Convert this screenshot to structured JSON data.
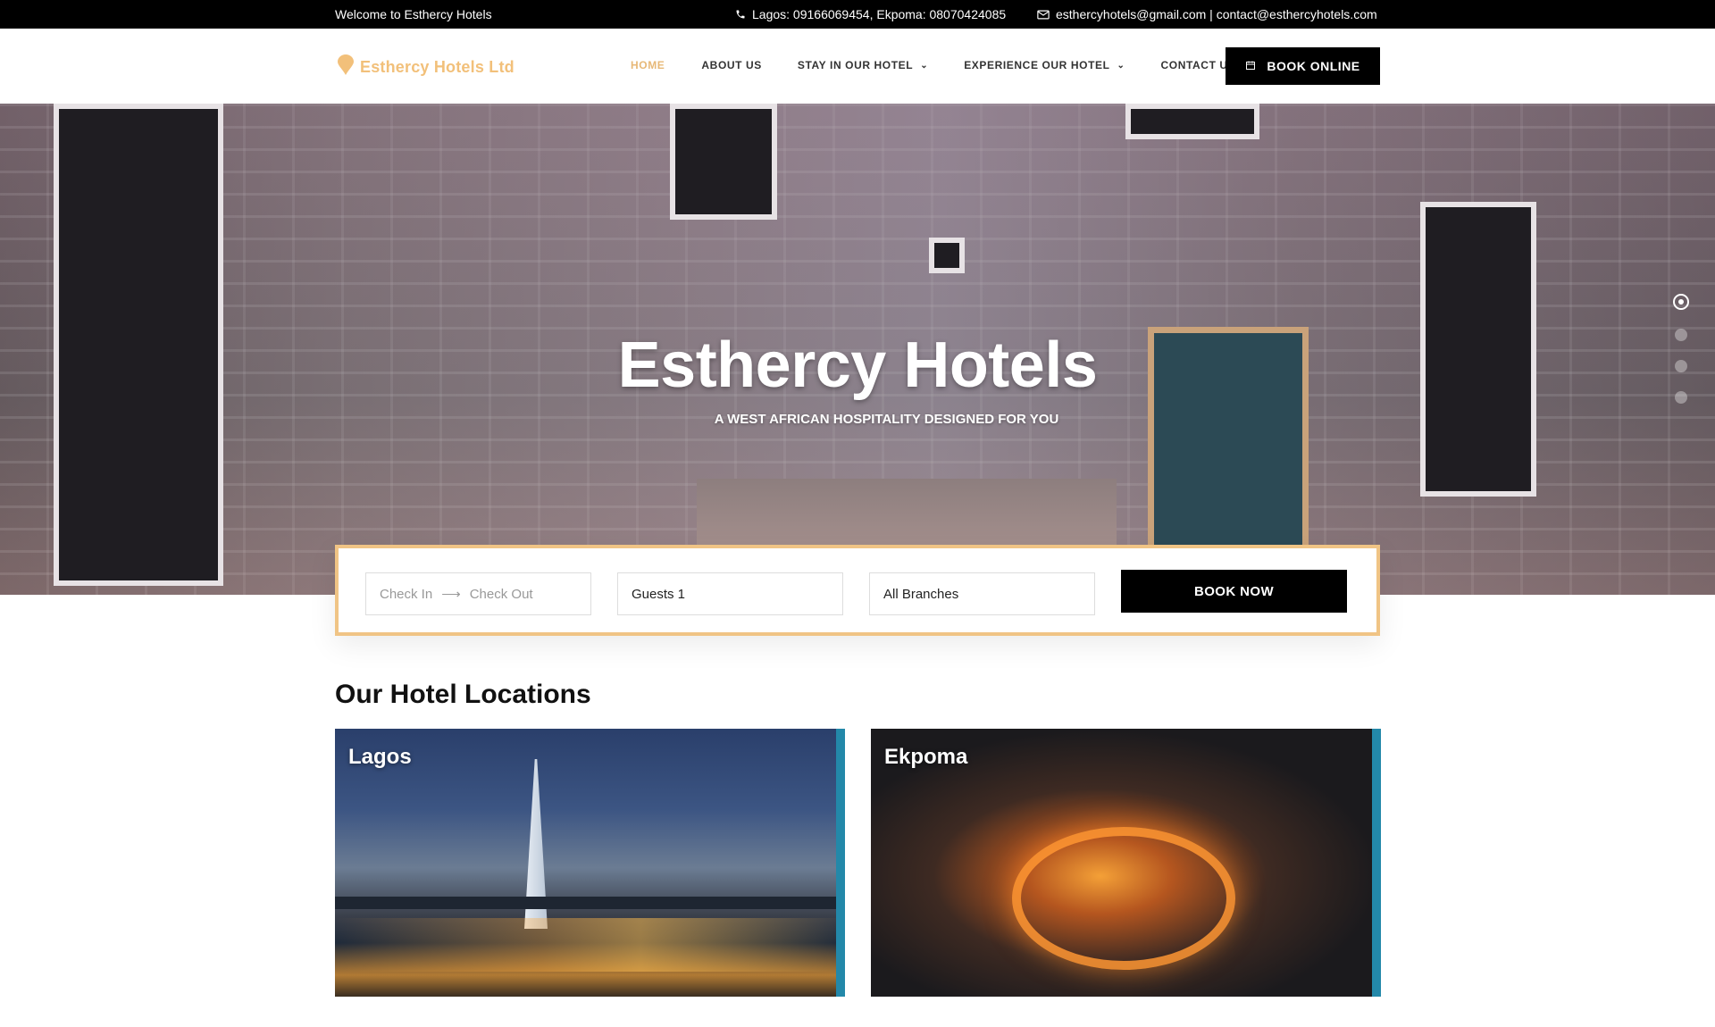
{
  "topbar": {
    "welcome": "Welcome to Esthercy Hotels",
    "phone": "Lagos: 09166069454, Ekpoma: 08070424085",
    "email": "esthercyhotels@gmail.com | contact@esthercyhotels.com"
  },
  "header": {
    "logo_text": "Esthercy Hotels Ltd",
    "nav": [
      {
        "label": "HOME",
        "active": true,
        "dropdown": false
      },
      {
        "label": "ABOUT US",
        "active": false,
        "dropdown": false
      },
      {
        "label": "STAY IN OUR HOTEL",
        "active": false,
        "dropdown": true
      },
      {
        "label": "EXPERIENCE OUR HOTEL",
        "active": false,
        "dropdown": true
      },
      {
        "label": "CONTACT US",
        "active": false,
        "dropdown": false
      }
    ],
    "book_online": "BOOK ONLINE"
  },
  "hero": {
    "title": "Esthercy Hotels",
    "subtitle": "A WEST AFRICAN HOSPITALITY DESIGNED FOR YOU",
    "slides": 4,
    "active_slide": 1
  },
  "booking": {
    "check_in_placeholder": "Check In",
    "check_out_placeholder": "Check Out",
    "guests_value": "Guests 1",
    "branch_value": "All Branches",
    "book_now": "BOOK NOW"
  },
  "locations": {
    "title": "Our Hotel Locations",
    "cards": [
      {
        "name": "Lagos"
      },
      {
        "name": "Ekpoma"
      }
    ]
  },
  "colors": {
    "accent": "#f0c485",
    "nav_active": "#e7b877",
    "topbar_bg": "#000000",
    "card_strip": "#2388a9"
  },
  "icons": {
    "phone": "phone-icon",
    "email": "envelope-icon",
    "calendar": "calendar-icon",
    "logo": "pin-icon"
  }
}
